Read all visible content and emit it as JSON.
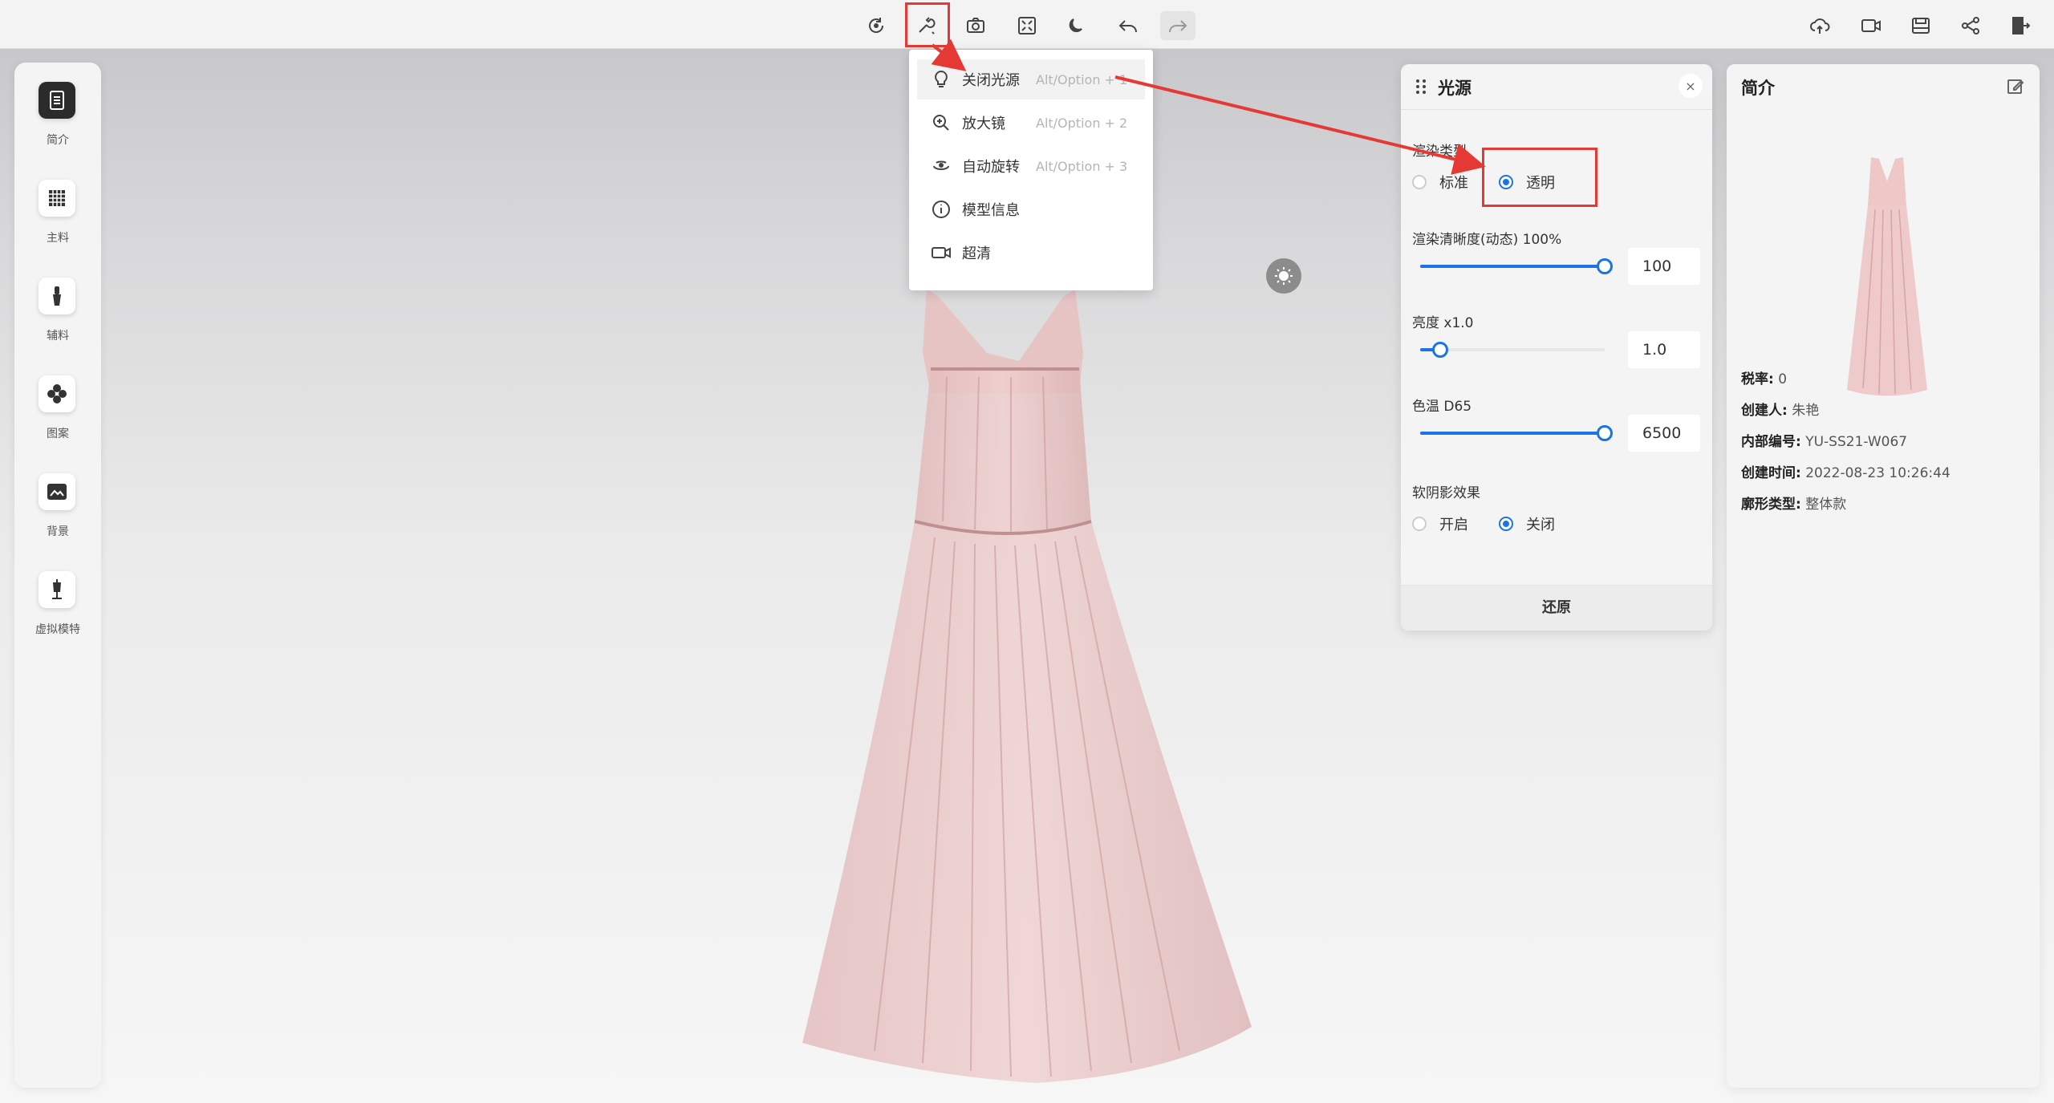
{
  "toolbar": {
    "center_icons": [
      "reset-view-icon",
      "wrench-icon",
      "camera-icon",
      "fullscreen-icon",
      "night-mode-icon",
      "undo-icon",
      "redo-icon"
    ],
    "right_icons": [
      "cloud-upload-icon",
      "video-icon",
      "save-icon",
      "share-icon",
      "exit-icon"
    ]
  },
  "sidebar": {
    "items": [
      {
        "label": "简介",
        "icon": "document-icon",
        "selected": true
      },
      {
        "label": "主料",
        "icon": "fabric-grid-icon",
        "selected": false
      },
      {
        "label": "辅料",
        "icon": "zipper-icon",
        "selected": false
      },
      {
        "label": "图案",
        "icon": "pattern-icon",
        "selected": false
      },
      {
        "label": "背景",
        "icon": "image-icon",
        "selected": false
      },
      {
        "label": "虚拟模特",
        "icon": "mannequin-icon",
        "selected": false
      }
    ]
  },
  "menu": {
    "items": [
      {
        "label": "关闭光源",
        "shortcut": "Alt/Option + 1",
        "icon": "bulb-icon"
      },
      {
        "label": "放大镜",
        "shortcut": "Alt/Option + 2",
        "icon": "magnifier-icon"
      },
      {
        "label": "自动旋转",
        "shortcut": "Alt/Option + 3",
        "icon": "rotate-icon"
      },
      {
        "label": "模型信息",
        "shortcut": "",
        "icon": "info-icon"
      },
      {
        "label": "超清",
        "shortcut": "",
        "icon": "hd-camera-icon"
      }
    ]
  },
  "light_panel": {
    "title": "光源",
    "close": "×",
    "render_type_label": "渲染类型",
    "render_options": [
      "标准",
      "透明"
    ],
    "render_selected": 1,
    "clarity_label": "渲染清晰度(动态) 100%",
    "clarity_value": "100",
    "clarity_level": 1.0,
    "brightness_label": "亮度 x1.0",
    "brightness_value": "1.0",
    "brightness_level": 0.11,
    "temp_label": "色温 D65",
    "temp_value": "6500",
    "temp_level": 1.0,
    "shadow_label": "软阴影效果",
    "shadow_options": [
      "开启",
      "关闭"
    ],
    "shadow_selected": 1,
    "reset": "还原"
  },
  "info_panel": {
    "title": "简介",
    "rows": [
      {
        "key": "税率:",
        "value": "0"
      },
      {
        "key": "创建人:",
        "value": "朱艳"
      },
      {
        "key": "内部编号:",
        "value": "YU-SS21-W067"
      },
      {
        "key": "创建时间:",
        "value": "2022-08-23 10:26:44"
      },
      {
        "key": "廓形类型:",
        "value": "整体款"
      }
    ]
  },
  "colors": {
    "accent": "#1a73e8",
    "annotation_red": "#e53935",
    "dress_pink": "#e9c3c3"
  }
}
